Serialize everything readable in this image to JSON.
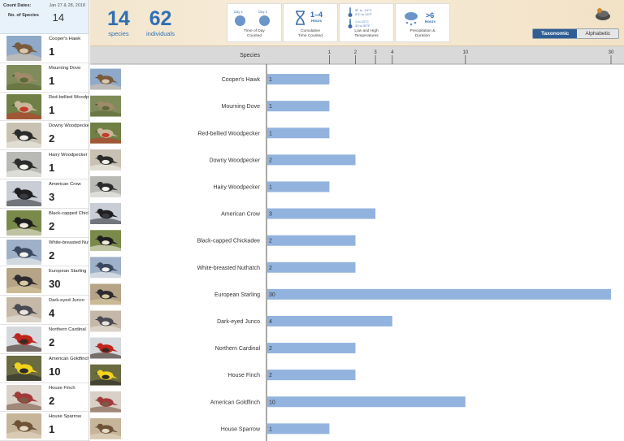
{
  "sidebar": {
    "count_dates_label": "Count Dates:",
    "count_dates_value": "Jan 27 & 28, 2018",
    "num_species_label": "No. of Species",
    "num_species_value": "14",
    "items": [
      {
        "name": "Cooper's Hawk",
        "count": "1"
      },
      {
        "name": "Mourning Dove",
        "count": "1"
      },
      {
        "name": "Red-bellied Woodpe",
        "count": "1"
      },
      {
        "name": "Downy Woodpecker",
        "count": "2"
      },
      {
        "name": "Hairy Woodpecker",
        "count": "1"
      },
      {
        "name": "American Crow",
        "count": "3"
      },
      {
        "name": "Black-capped Chicka",
        "count": "2"
      },
      {
        "name": "White-breasted Nut",
        "count": "2"
      },
      {
        "name": "European Starling",
        "count": "30"
      },
      {
        "name": "Dark-eyed Junco",
        "count": "4"
      },
      {
        "name": "Northern Cardinal",
        "count": "2"
      },
      {
        "name": "American Goldfinch",
        "count": "10"
      },
      {
        "name": "House Finch",
        "count": "2"
      },
      {
        "name": "House Sparrow",
        "count": "1"
      }
    ]
  },
  "header": {
    "species_count": "14",
    "species_label": "species",
    "individuals_count": "62",
    "individuals_label": "individuals",
    "card_time_of_day": {
      "day1": "Day 1",
      "day2": "Day 2",
      "caption_line1": "Time of Day",
      "caption_line2": "Counted"
    },
    "card_cumulative": {
      "value": "1–4",
      "unit": "Hours",
      "caption_line1": "Cumulative",
      "caption_line2": "Time Counted"
    },
    "card_temperature": {
      "high": "0F to -15°C",
      "high2": "5°C to 15°F",
      "low": "1 to 10°C",
      "low2": "33 to 50°F",
      "caption_line1": "Low and High",
      "caption_line2": "Temperatures"
    },
    "card_precip": {
      "value": ">6",
      "unit": "Hours",
      "caption_line1": "Precipitation &",
      "caption_line2": "Duration"
    },
    "sort_taxonomic": "Taxonomic",
    "sort_alphabetic": "Alphabetic"
  },
  "chart_data": {
    "type": "bar",
    "orientation": "horizontal",
    "axis_header": "Species",
    "x_ticks": [
      1,
      2,
      3,
      4,
      10,
      30
    ],
    "x_scale": "sqrt",
    "xlim": [
      0,
      30
    ],
    "categories": [
      "Cooper's Hawk",
      "Mourning Dove",
      "Red-bellied Woodpecker",
      "Downy Woodpecker",
      "Hairy Woodpecker",
      "American Crow",
      "Black-capped Chickadee",
      "White-breasted Nuthatch",
      "European Starling",
      "Dark-eyed Junco",
      "Northern Cardinal",
      "House Finch",
      "American Goldfinch",
      "House Sparrow"
    ],
    "values": [
      1,
      1,
      1,
      2,
      1,
      3,
      2,
      2,
      30,
      4,
      2,
      2,
      10,
      1
    ],
    "bar_color": "#93b3df"
  },
  "colors": {
    "accent": "#2f6fb4",
    "toggle_active": "#2f5d94",
    "bar": "#93b3df"
  }
}
